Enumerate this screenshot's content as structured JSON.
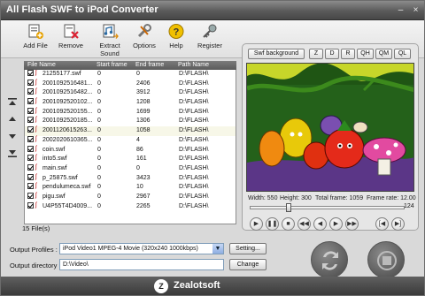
{
  "window": {
    "title": "All Flash SWF to iPod Converter",
    "min": "–",
    "close": "×"
  },
  "toolbar": {
    "add_file": "Add File",
    "remove": "Remove",
    "extract_sound": "Extract Sound",
    "options": "Options",
    "help": "Help",
    "register": "Register"
  },
  "list": {
    "columns": {
      "file_name": "File Name",
      "start_frame": "Start frame",
      "end_frame": "End frame",
      "path_name": "Path Name"
    },
    "rows": [
      {
        "name": "21255177.swf",
        "start": "0",
        "end": "0",
        "path": "D:\\FLASH\\"
      },
      {
        "name": "2001092516481...",
        "start": "0",
        "end": "2406",
        "path": "D:\\FLASH\\"
      },
      {
        "name": "2001092516482...",
        "start": "0",
        "end": "3912",
        "path": "D:\\FLASH\\"
      },
      {
        "name": "2001092520102...",
        "start": "0",
        "end": "1208",
        "path": "D:\\FLASH\\"
      },
      {
        "name": "2001092520155...",
        "start": "0",
        "end": "1699",
        "path": "D:\\FLASH\\"
      },
      {
        "name": "2001092520185...",
        "start": "0",
        "end": "1306",
        "path": "D:\\FLASH\\"
      },
      {
        "name": "2001120615263...",
        "start": "0",
        "end": "1058",
        "path": "D:\\FLASH\\"
      },
      {
        "name": "2002020610365...",
        "start": "0",
        "end": "4",
        "path": "D:\\FLASH\\"
      },
      {
        "name": "coin.swf",
        "start": "0",
        "end": "86",
        "path": "D:\\FLASH\\"
      },
      {
        "name": "into5.swf",
        "start": "0",
        "end": "161",
        "path": "D:\\FLASH\\"
      },
      {
        "name": "main.swf",
        "start": "0",
        "end": "0",
        "path": "D:\\FLASH\\"
      },
      {
        "name": "p_25875.swf",
        "start": "0",
        "end": "3423",
        "path": "D:\\FLASH\\"
      },
      {
        "name": "pendulumeca.swf",
        "start": "0",
        "end": "10",
        "path": "D:\\FLASH\\"
      },
      {
        "name": "pigu.swf",
        "start": "0",
        "end": "2967",
        "path": "D:\\FLASH\\"
      },
      {
        "name": "U4P55T4D4009...",
        "start": "0",
        "end": "2265",
        "path": "D:\\FLASH\\"
      }
    ],
    "count": "15 File(s)"
  },
  "preview": {
    "swf_background": "Swf background",
    "zoom": [
      "Z",
      "D",
      "R",
      "QH",
      "QM",
      "QL"
    ],
    "width": "Width: 550",
    "height": "Height: 300",
    "total_frame": "Total frame: 1059",
    "frame_rate": "Frame rate: 12.00",
    "slider_value": "124",
    "slider_fraction": 0.25
  },
  "output": {
    "profiles_label": "Output Profiles :",
    "profile_value": "iPod Video1 MPEG-4 Movie (320x240 1000kbps)",
    "setting_btn": "Setting...",
    "dir_label": "Output directory :",
    "dir_value": "D:\\Video\\",
    "change_btn": "Change"
  },
  "footer": {
    "brand": "Zealotsoft",
    "logo_letter": "Z"
  },
  "colors": {
    "accent": "#2a6aa3",
    "title_bg": "#555555"
  }
}
